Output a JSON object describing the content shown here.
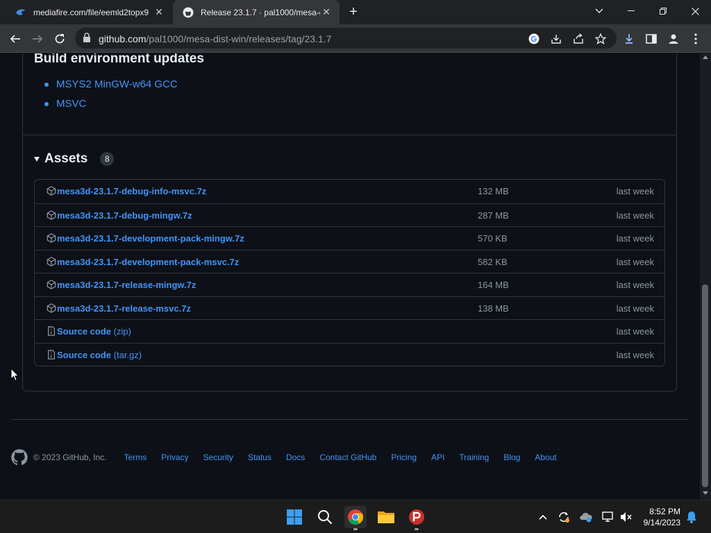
{
  "browser": {
    "tabs": [
      {
        "title": "mediafire.com/file/eemld2topx9",
        "active": false
      },
      {
        "title": "Release 23.1.7 · pal1000/mesa-di",
        "active": true
      }
    ],
    "address": {
      "host": "github.com",
      "path": "/pal1000/mesa-dist-win/releases/tag/23.1.7"
    }
  },
  "release": {
    "build_env_title": "Build environment updates",
    "build_env_items": [
      "MSYS2 MinGW-w64 GCC",
      "MSVC"
    ],
    "assets_title": "Assets",
    "assets_count": "8",
    "assets": [
      {
        "name": "mesa3d-23.1.7-debug-info-msvc.7z",
        "suffix": "",
        "size": "132 MB",
        "date": "last week",
        "icon": "package-icon"
      },
      {
        "name": "mesa3d-23.1.7-debug-mingw.7z",
        "suffix": "",
        "size": "287 MB",
        "date": "last week",
        "icon": "package-icon"
      },
      {
        "name": "mesa3d-23.1.7-development-pack-mingw.7z",
        "suffix": "",
        "size": "570 KB",
        "date": "last week",
        "icon": "package-icon"
      },
      {
        "name": "mesa3d-23.1.7-development-pack-msvc.7z",
        "suffix": "",
        "size": "582 KB",
        "date": "last week",
        "icon": "package-icon"
      },
      {
        "name": "mesa3d-23.1.7-release-mingw.7z",
        "suffix": "",
        "size": "164 MB",
        "date": "last week",
        "icon": "package-icon"
      },
      {
        "name": "mesa3d-23.1.7-release-msvc.7z",
        "suffix": "",
        "size": "138 MB",
        "date": "last week",
        "icon": "package-icon"
      },
      {
        "name": "Source code",
        "suffix": " (zip)",
        "size": "",
        "date": "last week",
        "icon": "file-zip-icon"
      },
      {
        "name": "Source code",
        "suffix": " (tar.gz)",
        "size": "",
        "date": "last week",
        "icon": "file-zip-icon"
      }
    ]
  },
  "footer": {
    "copyright": "© 2023 GitHub, Inc.",
    "links": [
      "Terms",
      "Privacy",
      "Security",
      "Status",
      "Docs",
      "Contact GitHub",
      "Pricing",
      "API",
      "Training",
      "Blog",
      "About"
    ]
  },
  "taskbar": {
    "time": "8:52 PM",
    "date": "9/14/2023"
  },
  "colors": {
    "link": "#4493f8",
    "page_bg": "#0d1117",
    "border": "#30363d",
    "muted": "#8d96a0"
  }
}
